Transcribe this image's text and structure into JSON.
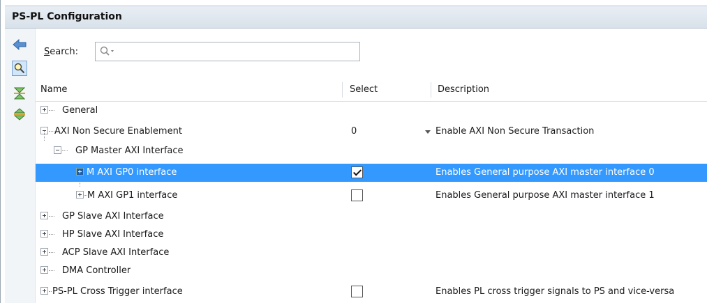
{
  "panel": {
    "title": "PS-PL Configuration"
  },
  "search": {
    "label_prefix": "S",
    "label_rest": "earch:",
    "value": ""
  },
  "table": {
    "columns": [
      "Name",
      "Select",
      "Description"
    ],
    "rows": [
      {
        "name": "General",
        "select": "",
        "description": ""
      },
      {
        "name": "AXI Non Secure Enablement",
        "select": "0",
        "description": "Enable AXI Non Secure Transaction"
      },
      {
        "name": "GP Master AXI Interface",
        "select": "",
        "description": ""
      },
      {
        "name": "M AXI GP0 interface",
        "select": "checked",
        "description": "Enables General purpose AXI master interface 0"
      },
      {
        "name": "M AXI GP1 interface",
        "select": "unchecked",
        "description": "Enables General purpose AXI master interface 1"
      },
      {
        "name": "GP Slave AXI Interface",
        "select": "",
        "description": ""
      },
      {
        "name": "HP Slave AXI Interface",
        "select": "",
        "description": ""
      },
      {
        "name": "ACP Slave AXI Interface",
        "select": "",
        "description": ""
      },
      {
        "name": "DMA Controller",
        "select": "",
        "description": ""
      },
      {
        "name": "PS-PL Cross Trigger interface",
        "select": "unchecked",
        "description": "Enables PL cross trigger signals to PS and vice-versa"
      }
    ]
  },
  "toolbar_icons": [
    "back-arrow-icon",
    "search-icon",
    "collapse-all-icon",
    "expand-all-icon"
  ],
  "colors": {
    "selection": "#3399ff",
    "header_bg": "#dfe6ee"
  }
}
